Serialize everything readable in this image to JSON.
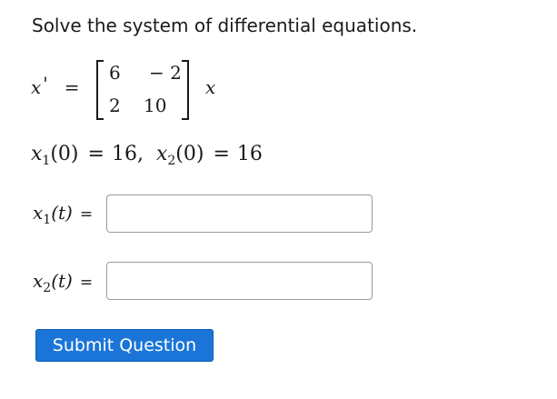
{
  "question": {
    "prompt": "Solve the system of differential equations.",
    "lhs_var": "x",
    "prime": "'",
    "equals": "=",
    "matrix": {
      "a11": "6",
      "a12": "− 2",
      "a21": "2",
      "a22": "10"
    },
    "rhs_var": "x"
  },
  "initial_conditions": {
    "x1_var": "x",
    "x1_sub": "1",
    "x1_arg": "(0)",
    "x1_value": "16,",
    "x2_var": "x",
    "x2_sub": "2",
    "x2_arg": "(0)",
    "x2_value": "16",
    "equals": "="
  },
  "answers": [
    {
      "var": "x",
      "sub": "1",
      "arg": "(t)",
      "equals": "=",
      "value": ""
    },
    {
      "var": "x",
      "sub": "2",
      "arg": "(t)",
      "equals": "=",
      "value": ""
    }
  ],
  "submit": {
    "label": "Submit Question"
  }
}
